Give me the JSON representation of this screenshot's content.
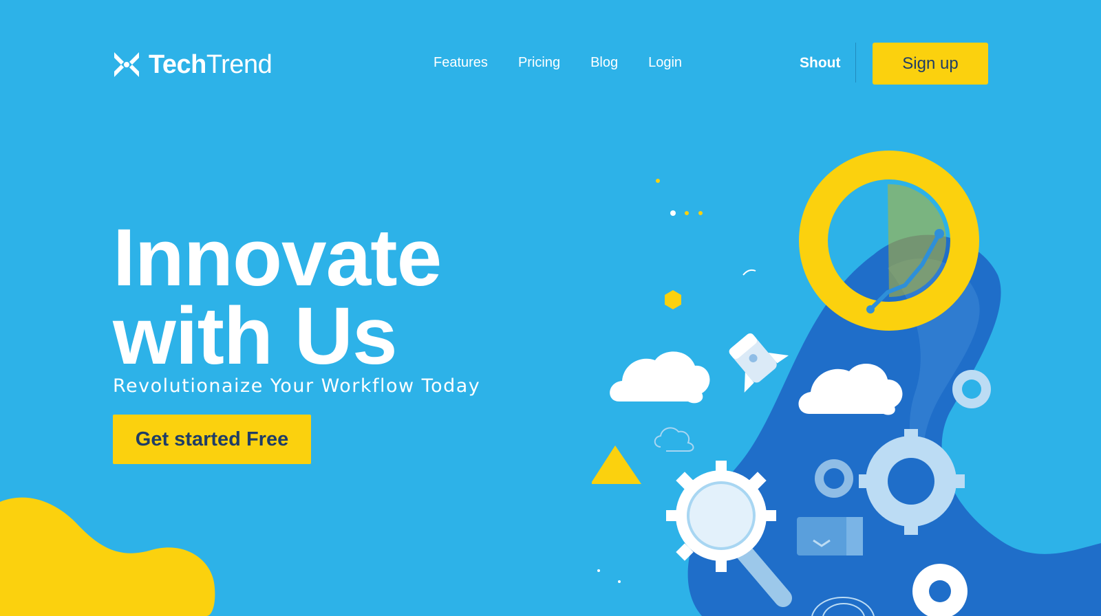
{
  "header": {
    "brand": {
      "prefix": "Tech",
      "suffix": "Trend"
    },
    "nav": [
      {
        "label": "Features"
      },
      {
        "label": "Pricing"
      },
      {
        "label": "Blog"
      },
      {
        "label": "Login"
      }
    ],
    "shout_label": "Shout",
    "signup_label": "Sign up"
  },
  "hero": {
    "title_line1": "Innovate",
    "title_line2": "with Us",
    "subtitle": "Revolutionaize Your Workflow Today",
    "cta_label": "Get started Free"
  },
  "colors": {
    "background": "#2db2e8",
    "accent": "#fbd10e",
    "button_text": "#1f3d66",
    "deep_blue": "#1f6ec9"
  },
  "icons": [
    "logo-mark-icon",
    "yellow-ring-icon",
    "cloud-icon",
    "rocket-icon",
    "gear-icon",
    "magnifier-icon",
    "triangle-icon",
    "hexagon-icon",
    "monitor-icon"
  ]
}
